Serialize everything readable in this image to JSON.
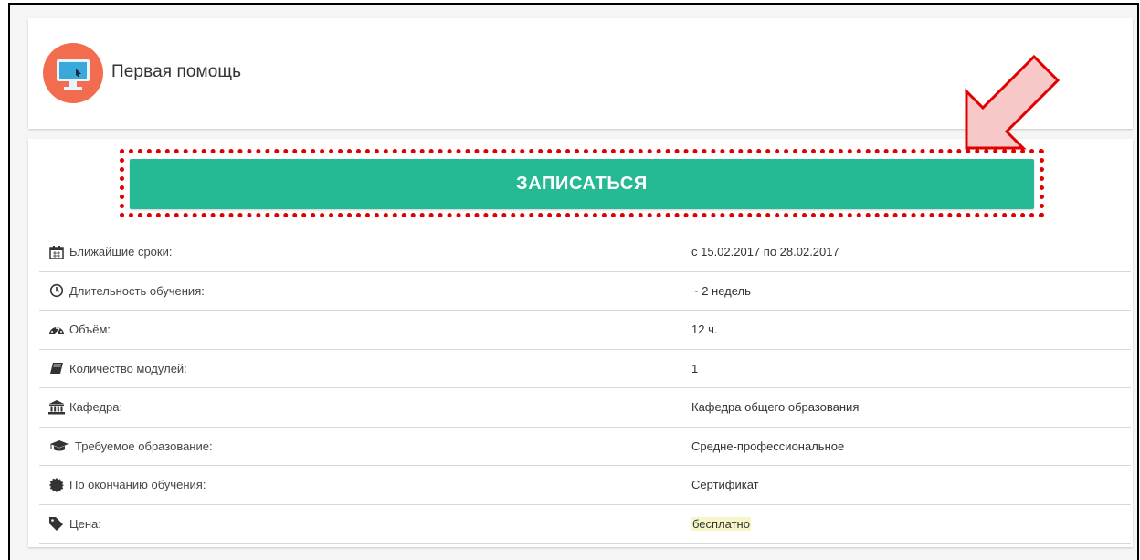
{
  "course": {
    "title": "Первая помощь",
    "icon": "monitor-icon"
  },
  "enroll_button": {
    "label": "ЗАПИСАТЬСЯ"
  },
  "colors": {
    "accent": "#25b994",
    "icon_bg": "#f26d50",
    "highlight": "#e00000",
    "arrow_fill": "#f8c8c8"
  },
  "details": [
    {
      "icon": "calendar-icon",
      "label": "Ближайшие сроки:",
      "value": "с 15.02.2017 по 28.02.2017"
    },
    {
      "icon": "clock-icon",
      "label": "Длительность обучения:",
      "value": "~ 2 недель"
    },
    {
      "icon": "gauge-icon",
      "label": "Объём:",
      "value": "12 ч."
    },
    {
      "icon": "book-icon",
      "label": "Количество модулей:",
      "value": "1"
    },
    {
      "icon": "institution-icon",
      "label": "Кафедра:",
      "value": "Кафедра общего образования"
    },
    {
      "icon": "graduation-cap-icon",
      "label": "Требуемое образование:",
      "value": "Средне-профессиональное"
    },
    {
      "icon": "certificate-icon",
      "label": "По окончанию обучения:",
      "value": "Сертификат"
    },
    {
      "icon": "tag-icon",
      "label": "Цена:",
      "value": "бесплатно"
    }
  ]
}
